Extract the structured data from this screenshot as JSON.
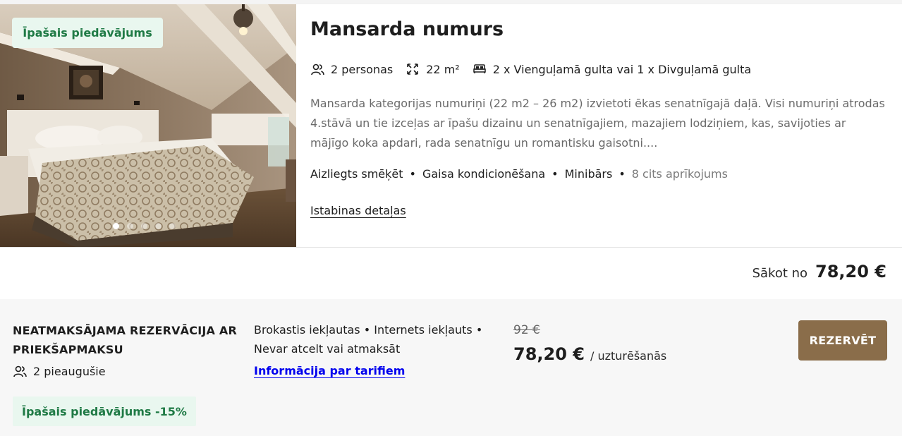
{
  "room": {
    "badge": "Īpašais piedāvājums",
    "title": "Mansarda numurs",
    "meta": {
      "persons": "2 personas",
      "size": "22 m²",
      "beds": "2 x Vienguļamā gulta vai 1 x Divguļamā gulta"
    },
    "description": "Mansarda kategorijas numuriņi (22 m2 – 26 m2) izvietoti ēkas senatnīgajā daļā. Visi numuriņi atrodas 4.stāvā un tie izceļas ar īpašu dizainu un senatnīgajiem, mazajiem lodziņiem, kas, savijoties ar mājīgo koka apdari, rada senatnīgu un romantisku gaisotni....",
    "amenities": [
      "Aizliegts smēķēt",
      "Gaisa kondicionēšana",
      "Minibārs"
    ],
    "more_amenities": "8 cits aprīkojums",
    "details_link": "Istabinas detaļas",
    "from_label": "Sākot no",
    "from_price": "78,20 €",
    "carousel": {
      "count": 5,
      "active": 0
    }
  },
  "rate": {
    "name": "NEATMAKSĀJAMA REZERVĀCIJA AR PRIEKŠAPMAKSU",
    "guests": "2 pieaugušie",
    "discount_badge": "Īpašais piedāvājums -15%",
    "includes": "Brokastis iekļautas • Internets iekļauts • Nevar atcelt vai atmaksāt",
    "tariff_link": "Informācija par tarifiem",
    "old_price": "92 €",
    "new_price": "78,20 €",
    "per": "/ uzturēšanās",
    "book_button": "REZERVĒT"
  },
  "colors": {
    "accent_button": "#8a6d4a",
    "badge_bg": "#e9f7ef",
    "badge_text": "#1f7a45"
  }
}
